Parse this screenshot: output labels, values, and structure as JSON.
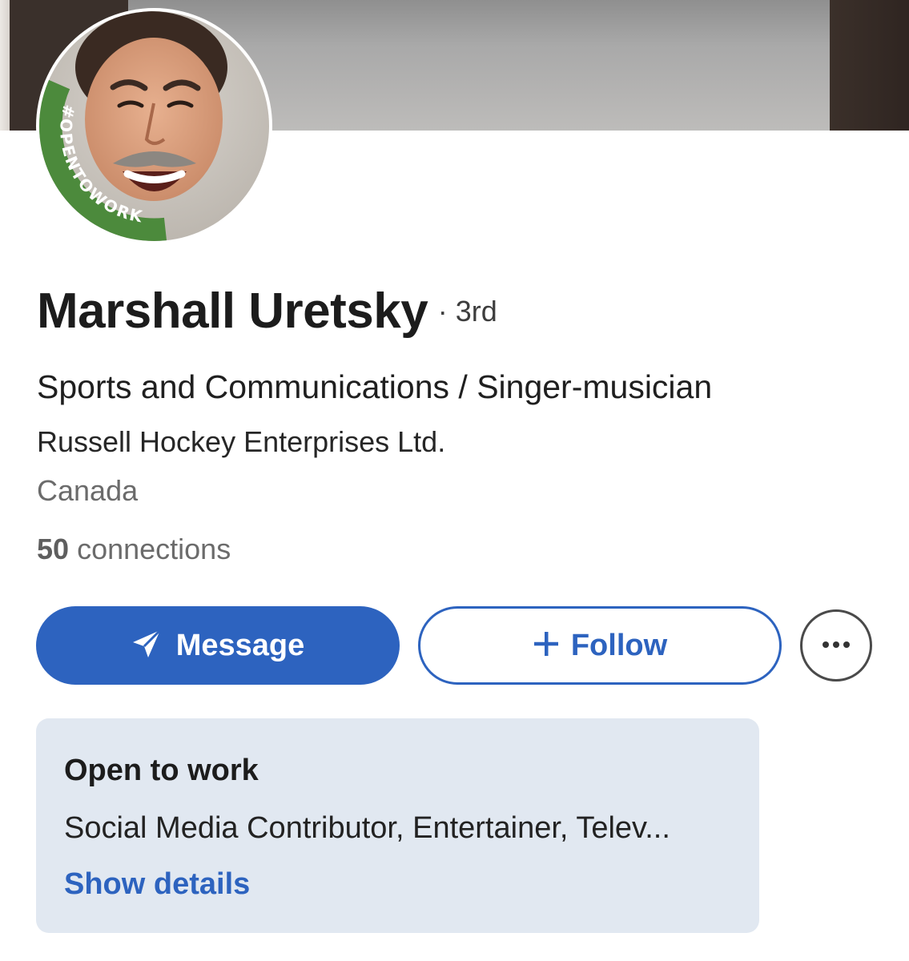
{
  "profile": {
    "name": "Marshall Uretsky",
    "degree": "· 3rd",
    "headline": "Sports and Communications / Singer-musician",
    "company": "Russell Hockey Enterprises Ltd.",
    "location": "Canada",
    "connections_count": "50",
    "connections_label": "connections",
    "avatar_badge": "#OPENTOWORK"
  },
  "actions": {
    "message_label": "Message",
    "message_icon": "send-icon",
    "follow_label": "Follow",
    "follow_icon": "plus-icon",
    "more_icon": "more-horizontal-icon"
  },
  "open_to_work": {
    "title": "Open to work",
    "description": "Social Media Contributor, Entertainer, Telev...",
    "link_label": "Show details"
  },
  "colors": {
    "accent": "#2d63bf",
    "badge_green": "#4c8a3c",
    "card_background": "#e1e8f1"
  }
}
